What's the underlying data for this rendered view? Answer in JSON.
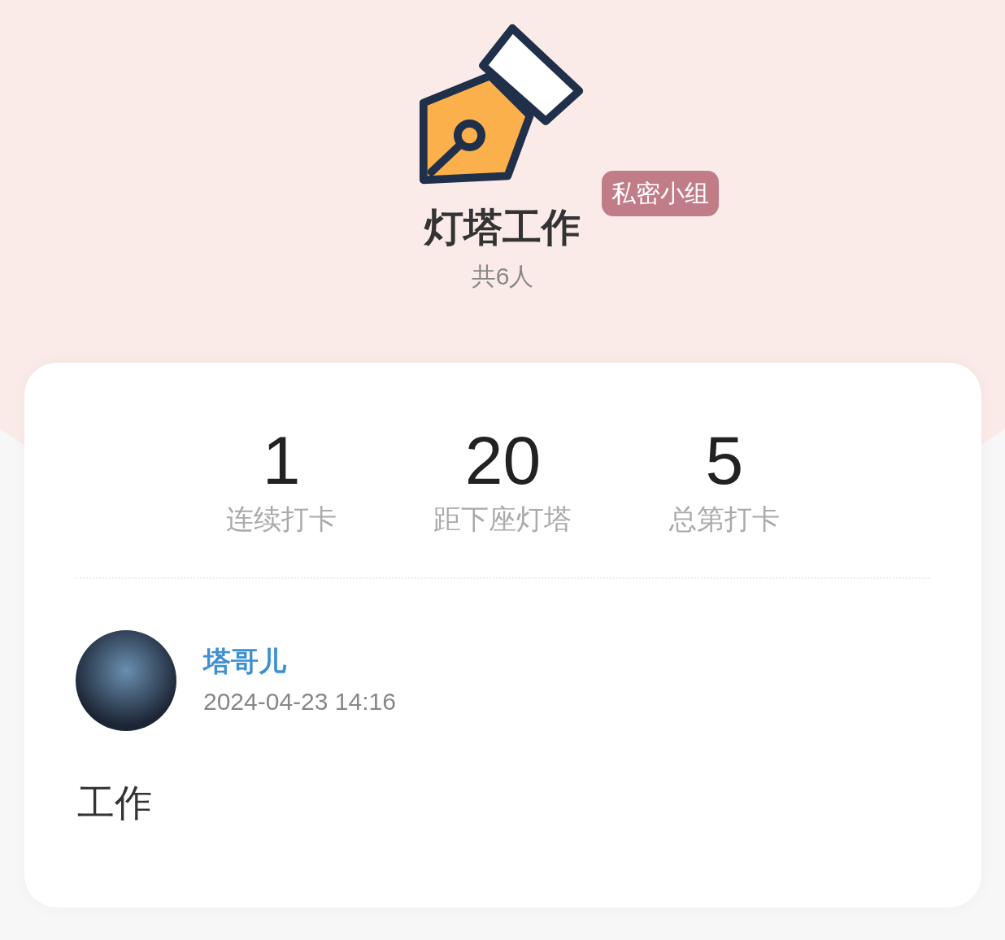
{
  "group": {
    "title": "灯塔工作",
    "badge": "私密小组",
    "members": "共6人"
  },
  "stats": [
    {
      "value": "1",
      "label": "连续打卡"
    },
    {
      "value": "20",
      "label": "距下座灯塔"
    },
    {
      "value": "5",
      "label": "总第打卡"
    }
  ],
  "post": {
    "author": "塔哥儿",
    "time": "2024-04-23 14:16",
    "content": "工作"
  }
}
